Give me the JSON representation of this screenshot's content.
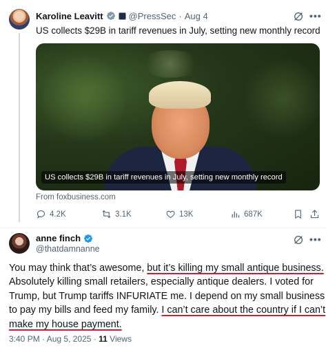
{
  "post1": {
    "author_name": "Karoline Leavitt",
    "handle": "@PressSec",
    "separator": "·",
    "date": "Aug 4",
    "text": "US collects $29B in tariff revenues in July, setting new monthly record",
    "media_caption": "US collects $29B in tariff revenues in July, setting new monthly record",
    "source": "From foxbusiness.com",
    "stats": {
      "replies": "4.2K",
      "reposts": "3.1K",
      "likes": "13K",
      "views": "687K"
    }
  },
  "post2": {
    "author_name": "anne finch",
    "handle": "@thatdamnanne",
    "lines": [
      [
        "You may think that’s awesome, ",
        "but it’s killing my small antique business."
      ],
      [
        "Absolutely killing small retailers, especially antique dealers. I voted for"
      ],
      [
        "Trump, but Trump tariffs INFURIATE me. I depend on my small business"
      ],
      [
        "to pay my bills and feed my family. ",
        "I can’t care about the country if I can’t"
      ],
      [
        "make my house payment."
      ]
    ],
    "time": "3:40 PM",
    "separator": "·",
    "date": "Aug 5, 2025",
    "views_count": "11",
    "views_label": "Views"
  },
  "colors": {
    "verified_blue": "#1d9bf0",
    "underline_red": "#e0142d",
    "secondary_text": "#536471"
  },
  "icons": [
    "verified-badge-icon",
    "government-badge-icon",
    "grok-icon",
    "more-icon",
    "reply-icon",
    "repost-icon",
    "like-icon",
    "views-icon",
    "bookmark-icon",
    "share-icon"
  ]
}
